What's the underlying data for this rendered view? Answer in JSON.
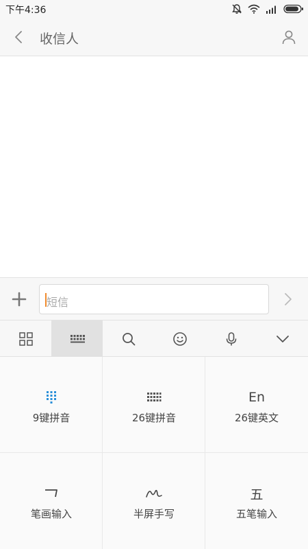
{
  "status": {
    "time": "下午4:36"
  },
  "header": {
    "title": "收信人"
  },
  "composer": {
    "placeholder": "短信"
  },
  "keyboard": {
    "options": [
      {
        "icon": "En",
        "label": "26键英文"
      },
      {
        "icon": "五",
        "label": "五笔输入"
      }
    ],
    "labels": {
      "nine_pinyin": "9键拼音",
      "pinyin26": "26键拼音",
      "english26": "26键英文",
      "stroke": "笔画输入",
      "handwriting": "半屏手写",
      "wubi": "五笔输入"
    },
    "glyphs": {
      "en": "En",
      "wu": "五"
    }
  },
  "colors": {
    "accent_blue": "#2a8fd8",
    "caret": "#f08a2c"
  }
}
